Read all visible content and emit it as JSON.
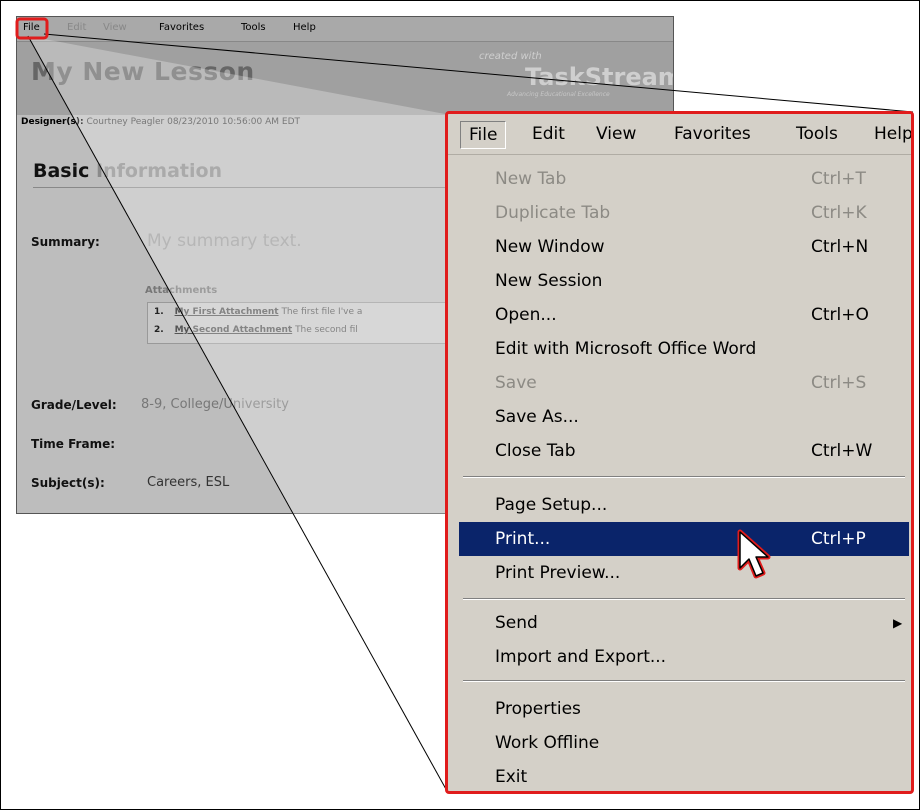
{
  "bg_window": {
    "menu": [
      "File",
      "Edit",
      "View",
      "Favorites",
      "Tools",
      "Help"
    ],
    "lesson_title": "My New Lesson",
    "created_with": "created with",
    "logo": "TaskStream",
    "logo_tagline": "Advancing Educational Excellence",
    "designer_label": "Designer(s):",
    "designer_value": "Courtney Peagler  08/23/2010 10:56:00 AM EDT",
    "section_title": "Basic Information",
    "section_title_bold": "Basic",
    "section_title_rest": " Information",
    "summary_label": "Summary:",
    "summary_value": "My summary text.",
    "attachments_title": "Attachments",
    "attachments": [
      {
        "num": "1.",
        "name": "My First Attachment",
        "desc": "The first file I've a"
      },
      {
        "num": "2.",
        "name": "My Second Attachment",
        "desc": "The second fil"
      }
    ],
    "grade_label": "Grade/Level:",
    "grade_value": "8-9, College/University",
    "timeframe_label": "Time Frame:",
    "subjects_label": "Subject(s):",
    "subjects_value": "Careers, ESL"
  },
  "menu_zoom": {
    "bar": [
      "File",
      "Edit",
      "View",
      "Favorites",
      "Tools",
      "Help"
    ],
    "items": [
      {
        "label": "New Tab",
        "shortcut": "Ctrl+T",
        "disabled": true
      },
      {
        "label": "Duplicate Tab",
        "shortcut": "Ctrl+K",
        "disabled": true
      },
      {
        "label": "New Window",
        "shortcut": "Ctrl+N"
      },
      {
        "label": "New Session",
        "shortcut": ""
      },
      {
        "label": "Open...",
        "shortcut": "Ctrl+O"
      },
      {
        "label": "Edit with Microsoft Office Word",
        "shortcut": ""
      },
      {
        "label": "Save",
        "shortcut": "Ctrl+S",
        "disabled": true
      },
      {
        "label": "Save As...",
        "shortcut": ""
      },
      {
        "label": "Close Tab",
        "shortcut": "Ctrl+W"
      },
      {
        "label": "Page Setup...",
        "shortcut": ""
      },
      {
        "label": "Print...",
        "shortcut": "Ctrl+P",
        "highlighted": true
      },
      {
        "label": "Print Preview...",
        "shortcut": ""
      },
      {
        "label": "Send",
        "shortcut": "",
        "submenu": true
      },
      {
        "label": "Import and Export...",
        "shortcut": ""
      },
      {
        "label": "Properties",
        "shortcut": ""
      },
      {
        "label": "Work Offline",
        "shortcut": ""
      },
      {
        "label": "Exit",
        "shortcut": ""
      }
    ]
  },
  "colors": {
    "callout_red": "#e01c1c",
    "menu_bg": "#d4d0c8",
    "highlight": "#0a246a"
  }
}
